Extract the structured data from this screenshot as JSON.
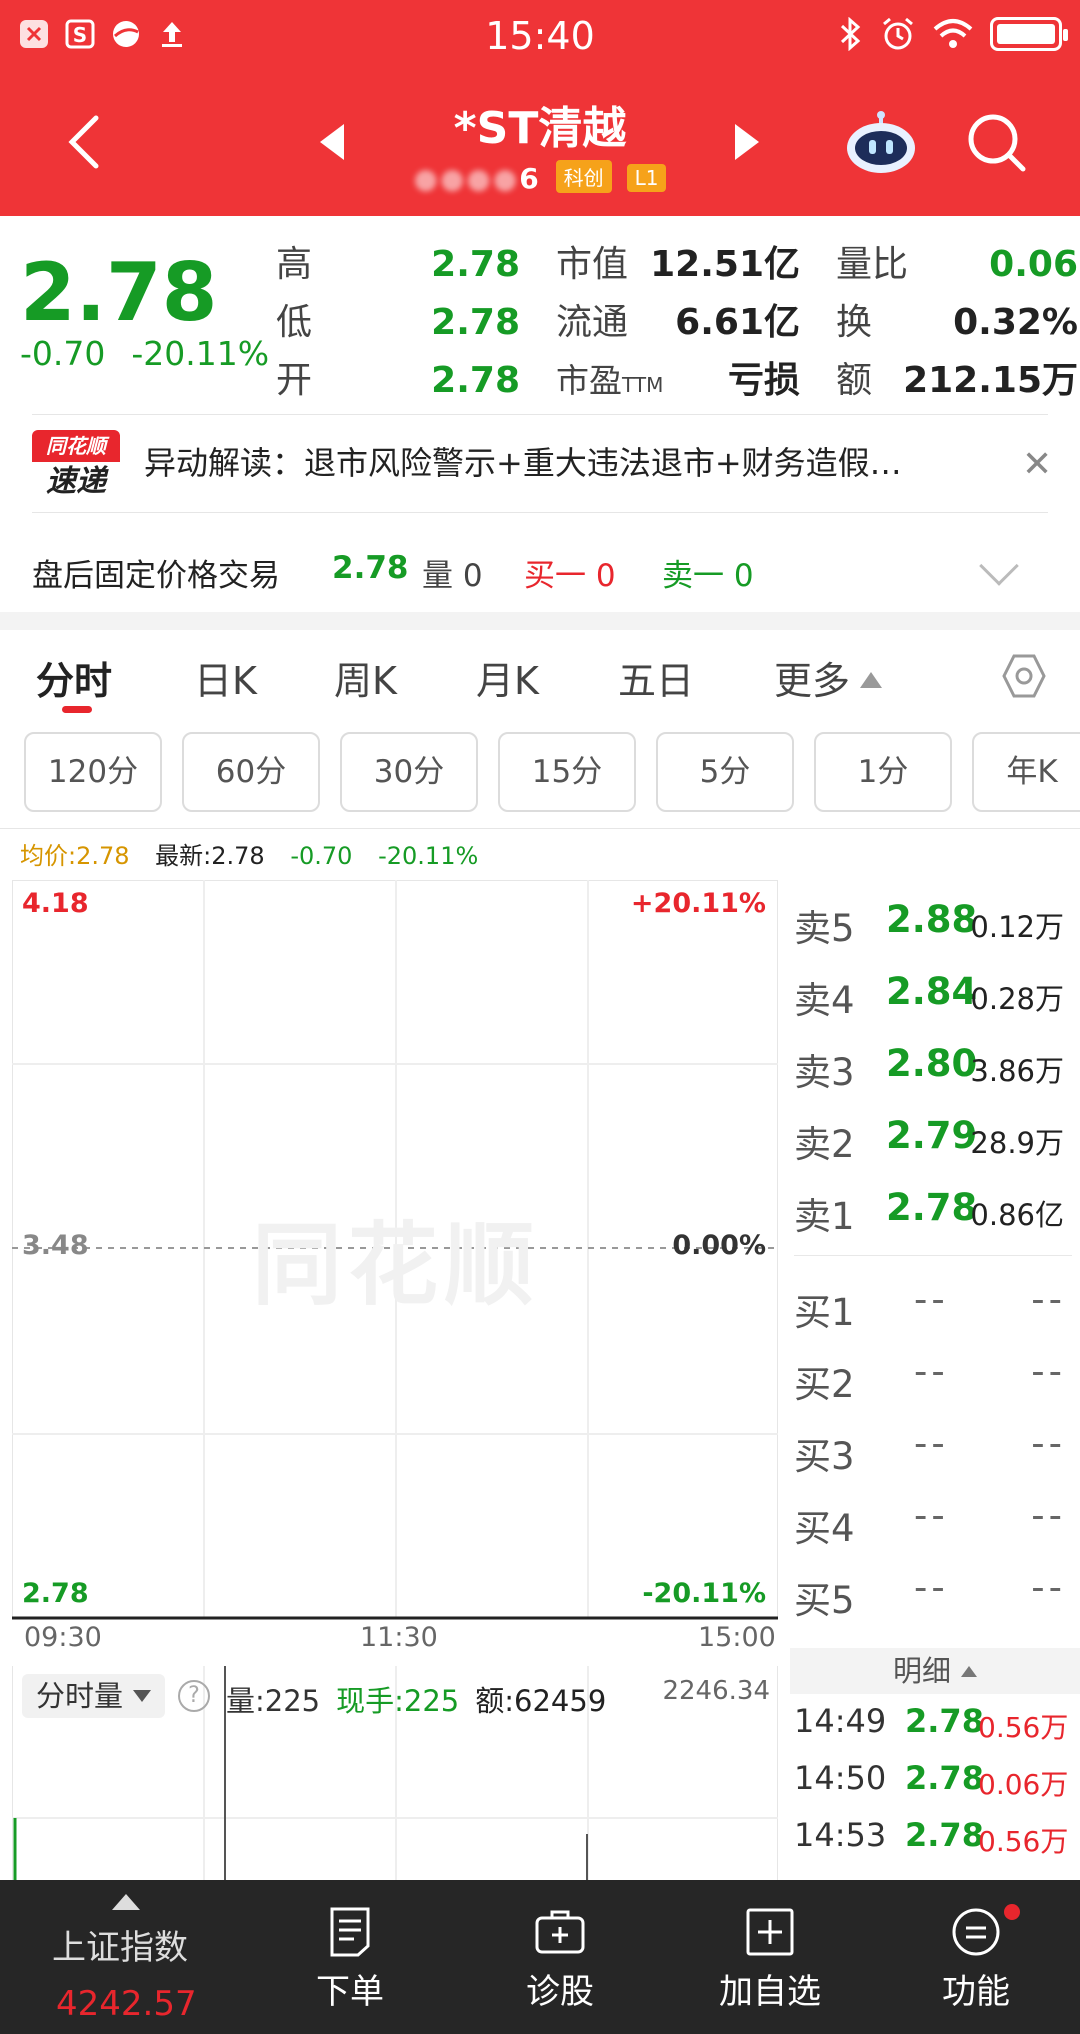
{
  "status_bar": {
    "time": "15:40"
  },
  "header": {
    "stock_name": "*ST清越",
    "stock_code_visible": "6",
    "tag_board": "科创",
    "tag_level": "L1"
  },
  "quote": {
    "price": "2.78",
    "change": "-0.70",
    "change_pct": "-20.11%",
    "rows": [
      {
        "l1": "高",
        "v1": "2.78",
        "l2": "市值",
        "v2": "12.51亿",
        "l3": "量比",
        "v3": "0.06"
      },
      {
        "l1": "低",
        "v1": "2.78",
        "l2": "流通",
        "v2": "6.61亿",
        "l3": "换",
        "v3": "0.32%"
      },
      {
        "l1": "开",
        "v1": "2.78",
        "l2": "市盈TTM",
        "v2": "亏损",
        "l3": "额",
        "v3": "212.15万"
      }
    ]
  },
  "news": {
    "badge_top": "同花顺",
    "badge_bottom": "速递",
    "text": "异动解读：退市风险警示+重大违法退市+财务造假…"
  },
  "after_hours": {
    "label": "盘后固定价格交易",
    "price": "2.78",
    "vol_label": "量 0",
    "buy1": "买一 0",
    "sell1": "卖一 0"
  },
  "tabs": [
    "分时",
    "日K",
    "周K",
    "月K",
    "五日",
    "更多"
  ],
  "periods": [
    "120分",
    "60分",
    "30分",
    "15分",
    "5分",
    "1分",
    "年K"
  ],
  "chart_head": {
    "avg": "均价:2.78",
    "latest": "最新:2.78",
    "chg": "-0.70",
    "pct": "-20.11%"
  },
  "chart": {
    "y_top": "4.18",
    "y_mid": "3.48",
    "y_bot": "2.78",
    "pct_top": "+20.11%",
    "pct_mid": "0.00%",
    "pct_bot": "-20.11%",
    "times": [
      "09:30",
      "11:30",
      "15:00"
    ],
    "watermark": "同花顺"
  },
  "order_book": {
    "asks": [
      {
        "label": "卖5",
        "price": "2.88",
        "vol": "0.12万"
      },
      {
        "label": "卖4",
        "price": "2.84",
        "vol": "0.28万"
      },
      {
        "label": "卖3",
        "price": "2.80",
        "vol": "3.86万"
      },
      {
        "label": "卖2",
        "price": "2.79",
        "vol": "28.9万"
      },
      {
        "label": "卖1",
        "price": "2.78",
        "vol": "0.86亿"
      }
    ],
    "bids": [
      {
        "label": "买1",
        "price": "--",
        "vol": "--"
      },
      {
        "label": "买2",
        "price": "--",
        "vol": "--"
      },
      {
        "label": "买3",
        "price": "--",
        "vol": "--"
      },
      {
        "label": "买4",
        "price": "--",
        "vol": "--"
      },
      {
        "label": "买5",
        "price": "--",
        "vol": "--"
      }
    ]
  },
  "detail": {
    "header": "明细",
    "rows": [
      {
        "time": "14:49",
        "price": "2.78",
        "vol": "0.56万"
      },
      {
        "time": "14:50",
        "price": "2.78",
        "vol": "0.06万"
      },
      {
        "time": "14:53",
        "price": "2.78",
        "vol": "0.56万"
      }
    ]
  },
  "volume": {
    "selector": "分时量",
    "vol": "量:225",
    "now": "现手:225",
    "amount": "额:62459",
    "max": "2246.34"
  },
  "bottom_bar": {
    "index_name": "上证指数",
    "index_value": "4242.57",
    "items": [
      "下单",
      "诊股",
      "加自选",
      "功能"
    ]
  }
}
